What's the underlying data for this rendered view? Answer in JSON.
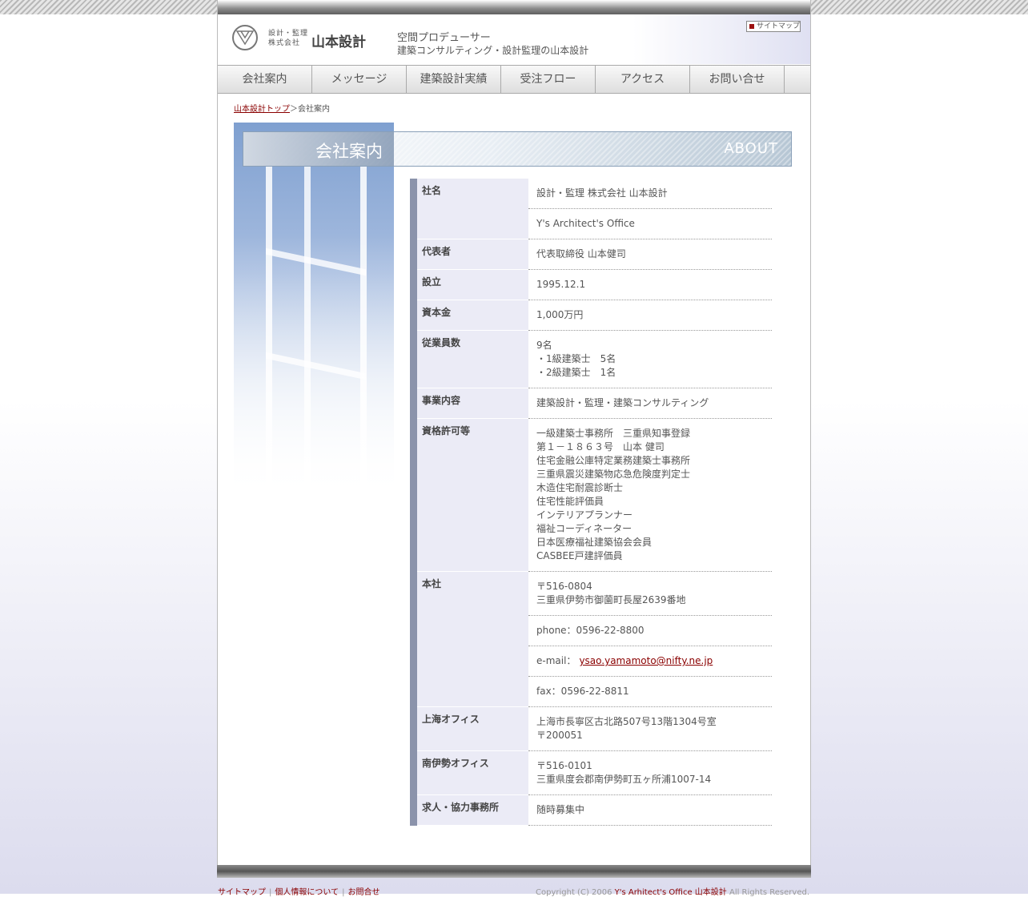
{
  "header": {
    "logo_sub_line1": "設計・監理",
    "logo_sub_line2": "株式会社",
    "logo_name": "山本設計",
    "tagline1": "空間プロデューサー",
    "tagline2": "建築コンサルティング・設計監理の山本設計",
    "sitemap_button": "サイトマップ"
  },
  "nav": [
    {
      "label": "会社案内"
    },
    {
      "label": "メッセージ"
    },
    {
      "label": "建築設計実績"
    },
    {
      "label": "受注フロー"
    },
    {
      "label": "アクセス"
    },
    {
      "label": "お問い合せ"
    }
  ],
  "breadcrumb": {
    "home": "山本設計トップ",
    "separator": "＞",
    "current": "会社案内"
  },
  "banner": {
    "title_jp": "会社案内",
    "title_en": "ABOUT"
  },
  "info_rows": [
    {
      "label": "社名",
      "values": [
        [
          "設計・監理 株式会社 山本設計"
        ],
        [
          "Y's Architect's Office"
        ]
      ]
    },
    {
      "label": "代表者",
      "values": [
        [
          "代表取締役 山本健司"
        ]
      ]
    },
    {
      "label": "設立",
      "values": [
        [
          "1995.12.1"
        ]
      ]
    },
    {
      "label": "資本金",
      "values": [
        [
          "1,000万円"
        ]
      ]
    },
    {
      "label": "従業員数",
      "values": [
        [
          "9名",
          "・1級建築士　5名",
          "・2級建築士　1名"
        ]
      ]
    },
    {
      "label": "事業内容",
      "values": [
        [
          "建築設計・監理・建築コンサルティング"
        ]
      ]
    },
    {
      "label": "資格許可等",
      "values": [
        [
          "一級建築士事務所　三重県知事登録",
          "第１－１８６３号　山本 健司",
          "住宅金融公庫特定業務建築士事務所",
          "三重県震災建築物応急危険度判定士",
          "木造住宅耐震診断士",
          "住宅性能評価員",
          "インテリアプランナー",
          "福祉コーディネーター",
          "日本医療福祉建築協会会員",
          "CASBEE戸建評価員"
        ]
      ]
    },
    {
      "label": "本社",
      "values": [
        [
          "〒516-0804",
          "三重県伊勢市御薗町長屋2639番地"
        ],
        [
          "phone：0596-22-8800"
        ],
        [
          "e-mail："
        ],
        [
          "fax：0596-22-8811"
        ]
      ]
    },
    {
      "label": "上海オフィス",
      "values": [
        [
          "上海市長寧区古北路507号13階1304号室",
          "〒200051"
        ]
      ]
    },
    {
      "label": "南伊勢オフィス",
      "values": [
        [
          "〒516-0101",
          "三重県度会郡南伊勢町五ヶ所浦1007-14"
        ]
      ]
    },
    {
      "label": "求人・協力事務所",
      "values": [
        [
          "随時募集中"
        ]
      ]
    }
  ],
  "email_link": "ysao.yamamoto@nifty.ne.jp",
  "footer": {
    "links": [
      "サイトマップ",
      "個人情報について",
      "お問合せ"
    ],
    "copyright_prefix": "Copyright (C) 2006 ",
    "copyright_brand": "Y's Arhitect's Office 山本設計",
    "copyright_suffix": " All Rights Reserved."
  }
}
